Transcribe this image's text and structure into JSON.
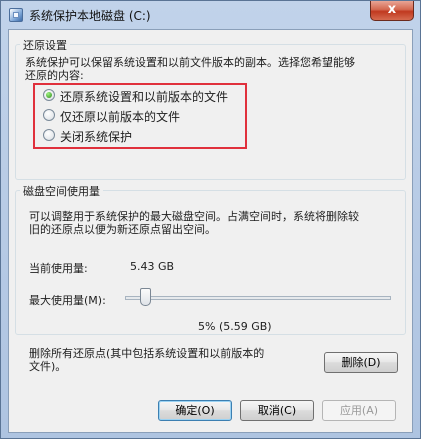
{
  "window": {
    "title": "系统保护本地磁盘 (C:)",
    "close_glyph": "x"
  },
  "restore_settings": {
    "group_title": "还原设置",
    "description": "系统保护可以保留系统设置和以前文件版本的副本。选择您希望能够\n还原的内容:",
    "options": [
      {
        "label": "还原系统设置和以前版本的文件",
        "selected": true
      },
      {
        "label": "仅还原以前版本的文件",
        "selected": false
      },
      {
        "label": "关闭系统保护",
        "selected": false
      }
    ]
  },
  "disk_usage": {
    "group_title": "磁盘空间使用量",
    "description": "可以调整用于系统保护的最大磁盘空间。占满空间时，系统将删除较\n旧的还原点以便为新还原点留出空间。",
    "current_label": "当前使用量:",
    "current_value": "5.43 GB",
    "max_label": "最大使用量(M):",
    "max_value": "5% (5.59 GB)",
    "max_percent": 5,
    "delete_text": "删除所有还原点(其中包括系统设置和以前版本的\n文件)。",
    "delete_button": "删除(D)"
  },
  "footer": {
    "ok_button": "确定(O)",
    "cancel_button": "取消(C)",
    "apply_button": "应用(A)"
  },
  "colors": {
    "highlight_border": "#e0303c"
  }
}
